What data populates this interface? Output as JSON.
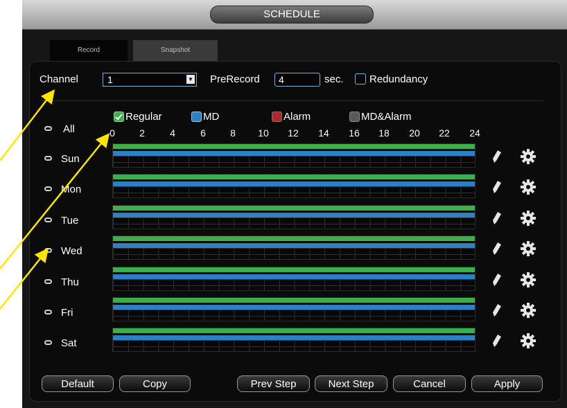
{
  "window_title": "SCHEDULE",
  "tabs": [
    {
      "label": "Record"
    },
    {
      "label": "Snapshot"
    }
  ],
  "channel": {
    "label": "Channel",
    "value": "1"
  },
  "prerecord": {
    "label": "PreRecord",
    "value": "4",
    "unit": "sec."
  },
  "redundancy": {
    "label": "Redundancy",
    "checked": false
  },
  "legend": [
    {
      "label": "Regular",
      "color": "#3dae4a",
      "checked": true
    },
    {
      "label": "MD",
      "color": "#2f7fc4",
      "checked": false
    },
    {
      "label": "Alarm",
      "color": "#b3262a",
      "checked": false
    },
    {
      "label": "MD&Alarm",
      "color": "#5a5a5a",
      "checked": false
    }
  ],
  "all_label": "All",
  "hour_ticks": [
    "0",
    "2",
    "4",
    "6",
    "8",
    "10",
    "12",
    "14",
    "16",
    "18",
    "20",
    "22",
    "24"
  ],
  "days": [
    {
      "label": "Sun",
      "regular": [
        0,
        24
      ],
      "md": [
        0,
        24
      ]
    },
    {
      "label": "Mon",
      "regular": [
        0,
        24
      ],
      "md": [
        0,
        24
      ]
    },
    {
      "label": "Tue",
      "regular": [
        0,
        24
      ],
      "md": [
        0,
        24
      ]
    },
    {
      "label": "Wed",
      "regular": [
        0,
        24
      ],
      "md": [
        0,
        24
      ]
    },
    {
      "label": "Thu",
      "regular": [
        0,
        24
      ],
      "md": [
        0,
        24
      ]
    },
    {
      "label": "Fri",
      "regular": [
        0,
        24
      ],
      "md": [
        0,
        24
      ]
    },
    {
      "label": "Sat",
      "regular": [
        0,
        24
      ],
      "md": [
        0,
        24
      ]
    }
  ],
  "row_icons": [
    "pencil-icon",
    "gear-icon"
  ],
  "buttons": {
    "default": "Default",
    "copy": "Copy",
    "prev": "Prev Step",
    "next": "Next Step",
    "cancel": "Cancel",
    "apply": "Apply"
  }
}
